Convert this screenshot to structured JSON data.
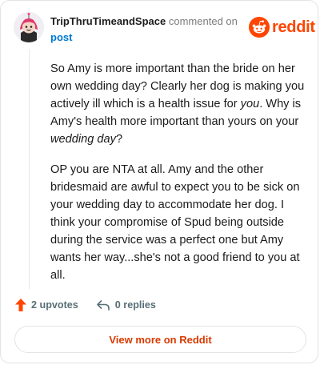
{
  "header": {
    "author": "TripThruTimeandSpace",
    "commented_on": "commented on",
    "post_link": "post",
    "brand": "reddit"
  },
  "comment": {
    "p1": {
      "a": "So Amy is more important than the bride on her own wedding day? Clearly her dog is making you actively ill which is a health issue for ",
      "em1": "you",
      "b": ". Why is Amy's health more important than yours on your ",
      "em2": "wedding day",
      "c": "?"
    },
    "p2": "OP you are NTA at all. Amy and the other bridesmaid are awful to expect you to be sick on your wedding day to accommodate her dog. I think your compromise of Spud being outside during the service was a perfect one but Amy wants her way...she's not a good friend to you at all."
  },
  "actions": {
    "upvotes": "2 upvotes",
    "replies": "0 replies"
  },
  "footer": {
    "view_more": "View more on Reddit"
  },
  "icons": {
    "avatar": "avatar-icon",
    "logo": "reddit-logo-icon",
    "upvote": "upvote-arrow-icon",
    "reply": "reply-arrow-icon"
  },
  "colors": {
    "brand": "#ff4500",
    "upvote": "#ff4500",
    "link": "#0079d3",
    "button_text": "#d93a00"
  }
}
